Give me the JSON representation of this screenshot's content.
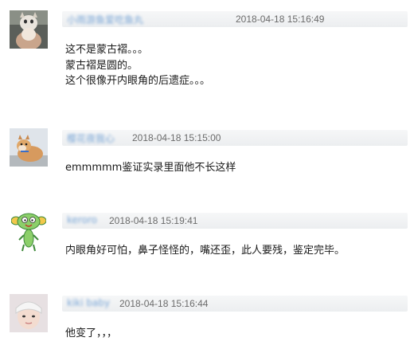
{
  "comments": [
    {
      "username": "小雨游鱼爱吃鱼丸",
      "timestamp": "2018-04-18 15:16:49",
      "lines": [
        "这不是蒙古褶。。。",
        "蒙古褶是圆的。",
        "这个很像开内眼角的后遗症。。。"
      ]
    },
    {
      "username": "樱花夜我心",
      "timestamp": "2018-04-18 15:15:00",
      "lines": [
        "emmmmm鉴证实录里面他不长这样"
      ]
    },
    {
      "username": "keroro",
      "timestamp": "2018-04-18 15:19:41",
      "lines": [
        "内眼角好可怕，鼻子怪怪的，嘴还歪，此人要残，鉴定完毕。"
      ]
    },
    {
      "username": "kiki baby",
      "timestamp": "2018-04-18 15:16:44",
      "lines": [
        "他变了，，，"
      ]
    }
  ]
}
